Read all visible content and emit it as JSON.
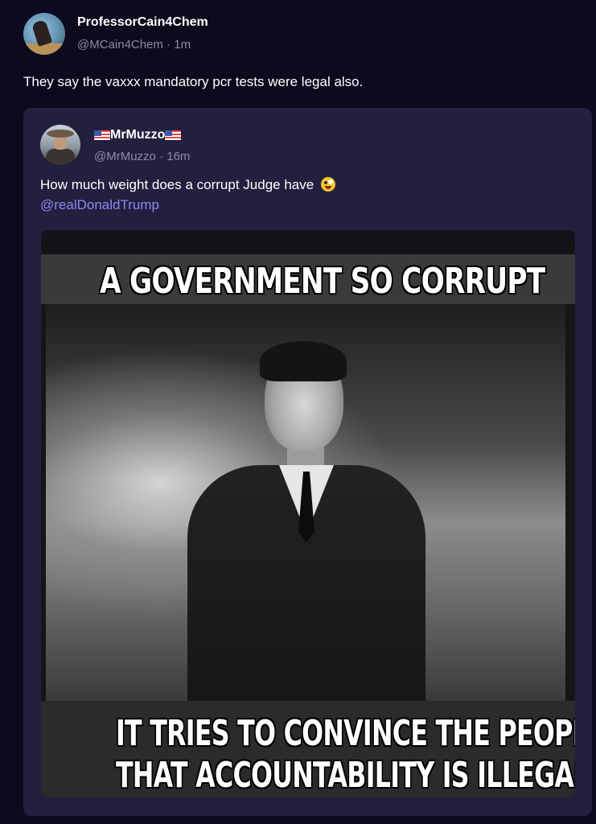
{
  "post": {
    "author": {
      "display_name": "ProfessorCain4Chem",
      "handle_time": "@MCain4Chem · 1m",
      "avatar_icon": "avatar-photo"
    },
    "text": "They say the vaxxx mandatory pcr tests were legal also."
  },
  "quote": {
    "author": {
      "display_name": "MrMuzzo",
      "flag_icon": "us-flag-icon",
      "handle_time": "@MrMuzzo · 16m",
      "avatar_icon": "avatar-photo"
    },
    "text": "How much weight does a corrupt Judge have",
    "emoji_icon": "zany-face-emoji",
    "mention": "@realDonaldTrump",
    "image": {
      "caption_top": "A GOVERNMENT SO CORRUPT",
      "caption_bottom_line1": "IT TRIES TO CONVINCE THE PEOPLE",
      "caption_bottom_line2": "THAT ACCOUNTABILITY IS ILLEGAL"
    }
  },
  "colors": {
    "background": "#0c0a1d",
    "card": "#231f3e",
    "mention": "#8f86f2",
    "muted": "#8d8aa3"
  }
}
